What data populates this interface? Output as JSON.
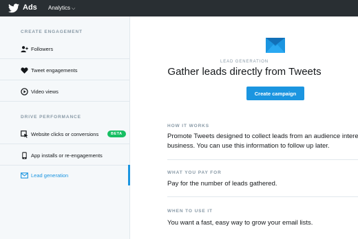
{
  "topbar": {
    "brand": "Ads",
    "nav_label": "Analytics",
    "bird_icon": "twitter-bird-icon",
    "chevron_icon": "chevron-down-icon"
  },
  "sidebar": {
    "section1_title": "CREATE ENGAGEMENT",
    "section2_title": "DRIVE PERFORMANCE",
    "items": [
      {
        "label": "Followers",
        "icon": "add-user-icon"
      },
      {
        "label": "Tweet engagements",
        "icon": "heart-icon"
      },
      {
        "label": "Video views",
        "icon": "play-icon"
      },
      {
        "label": "Website clicks or conversions",
        "icon": "cursor-icon",
        "badge": "BETA"
      },
      {
        "label": "App installs or re-engagements",
        "icon": "phone-icon"
      },
      {
        "label": "Lead generation",
        "icon": "envelope-icon",
        "active": true
      }
    ]
  },
  "main": {
    "kicker": "LEAD GENERATION",
    "headline": "Gather leads directly from Tweets",
    "cta_label": "Create campaign",
    "how_title": "HOW IT WORKS",
    "how_line1": "Promote Tweets designed to collect leads from an audience interes",
    "how_line2": "business. You can use this information to follow up later.",
    "pay_title": "WHAT YOU PAY FOR",
    "pay_text": "Pay for the number of leads gathered.",
    "when_title": "WHEN TO USE IT",
    "when_text": "You want a fast, easy way to grow your email lists."
  },
  "colors": {
    "topbar": "#292f33",
    "accent": "#1b95e0",
    "beta": "#17bf63",
    "muted": "#8899a6"
  }
}
